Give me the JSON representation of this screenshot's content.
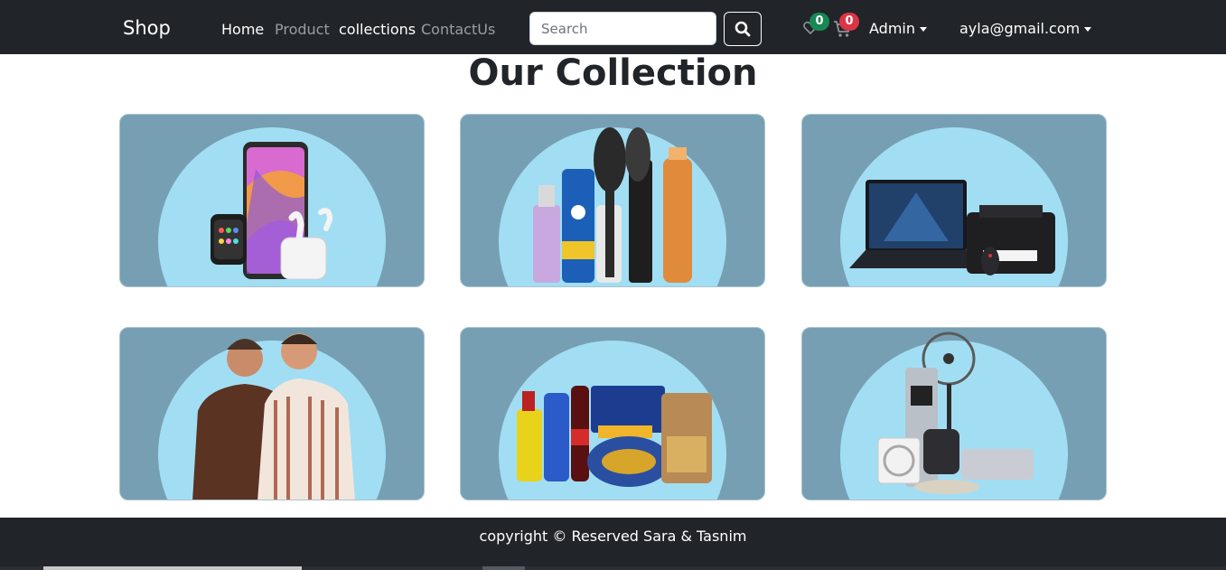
{
  "navbar": {
    "brand": "Shop",
    "links": [
      {
        "label": "Home"
      },
      {
        "label": "Product"
      },
      {
        "label": "collections"
      },
      {
        "label": "ContactUs"
      }
    ],
    "search": {
      "placeholder": "Search",
      "value": ""
    },
    "wishlist_count": "0",
    "cart_count": "0",
    "admin_label": "Admin",
    "user_email": "ayla@gmail.com",
    "colors": {
      "background": "#212529",
      "wishlist_badge": "#198754",
      "cart_badge": "#dc3545"
    }
  },
  "main": {
    "title": "Our Collection",
    "collections": [
      {
        "icon": "phone-watch-earbuds-image"
      },
      {
        "icon": "beauty-products-image"
      },
      {
        "icon": "laptop-printer-image"
      },
      {
        "icon": "men-clothing-image"
      },
      {
        "icon": "groceries-image"
      },
      {
        "icon": "home-appliances-image"
      }
    ],
    "colors": {
      "card": "#779fb3",
      "circle": "#a2def3"
    }
  },
  "footer": {
    "text": "copyright © Reserved Sara & Tasnim"
  }
}
